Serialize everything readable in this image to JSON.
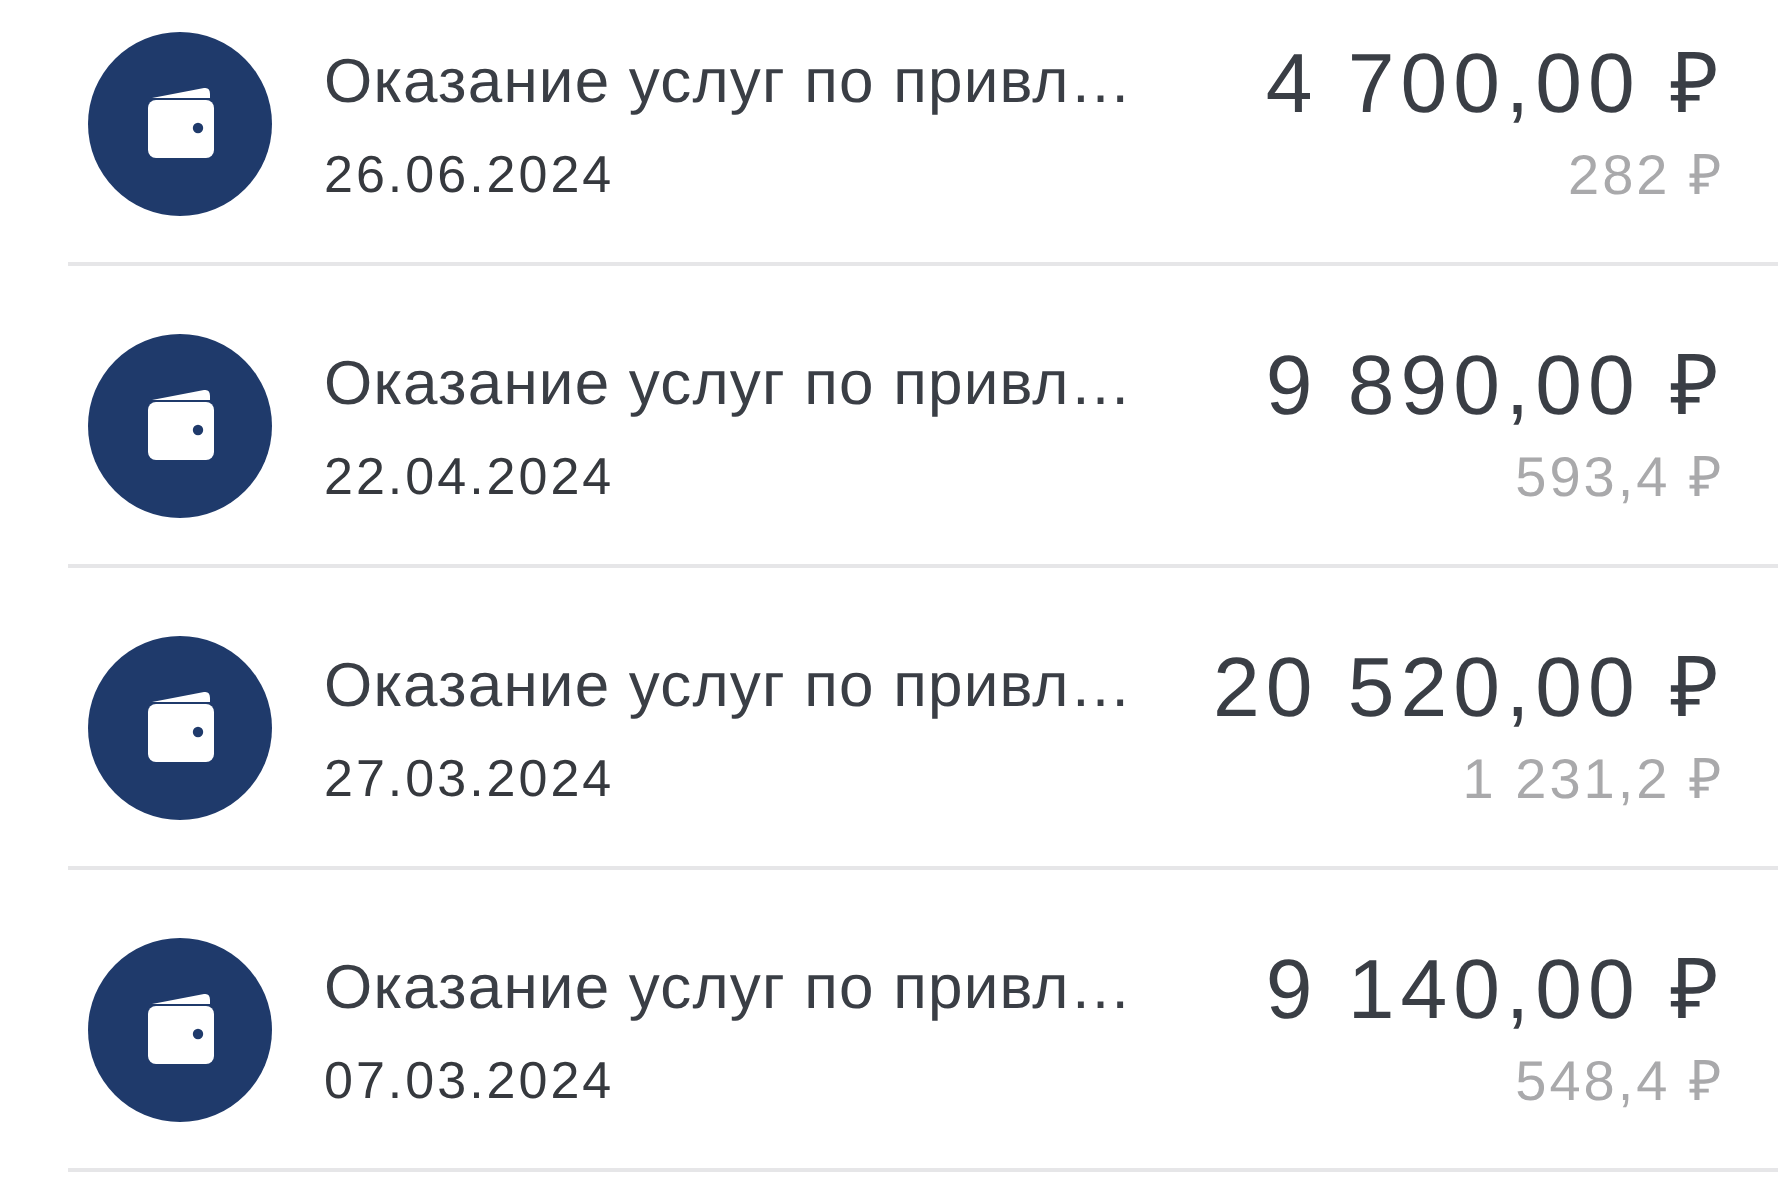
{
  "transactions": [
    {
      "title": "Оказание услуг по привл…",
      "date": "26.06.2024",
      "amount": "4 700,00 ₽",
      "secondary_amount": "282 ₽"
    },
    {
      "title": "Оказание услуг по привл…",
      "date": "22.04.2024",
      "amount": "9 890,00 ₽",
      "secondary_amount": "593,4 ₽"
    },
    {
      "title": "Оказание услуг по привл…",
      "date": "27.03.2024",
      "amount": "20 520,00 ₽",
      "secondary_amount": "1 231,2 ₽"
    },
    {
      "title": "Оказание услуг по привл…",
      "date": "07.03.2024",
      "amount": "9 140,00 ₽",
      "secondary_amount": "548,4 ₽"
    }
  ]
}
